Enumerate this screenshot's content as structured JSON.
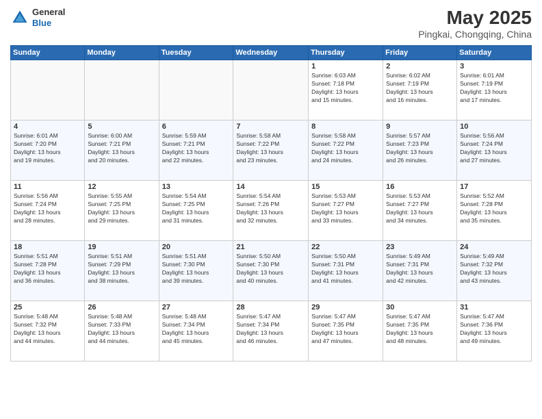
{
  "header": {
    "logo": {
      "general": "General",
      "blue": "Blue"
    },
    "title": "May 2025",
    "subtitle": "Pingkai, Chongqing, China"
  },
  "weekdays": [
    "Sunday",
    "Monday",
    "Tuesday",
    "Wednesday",
    "Thursday",
    "Friday",
    "Saturday"
  ],
  "weeks": [
    [
      {
        "day": "",
        "info": ""
      },
      {
        "day": "",
        "info": ""
      },
      {
        "day": "",
        "info": ""
      },
      {
        "day": "",
        "info": ""
      },
      {
        "day": "1",
        "info": "Sunrise: 6:03 AM\nSunset: 7:18 PM\nDaylight: 13 hours\nand 15 minutes."
      },
      {
        "day": "2",
        "info": "Sunrise: 6:02 AM\nSunset: 7:19 PM\nDaylight: 13 hours\nand 16 minutes."
      },
      {
        "day": "3",
        "info": "Sunrise: 6:01 AM\nSunset: 7:19 PM\nDaylight: 13 hours\nand 17 minutes."
      }
    ],
    [
      {
        "day": "4",
        "info": "Sunrise: 6:01 AM\nSunset: 7:20 PM\nDaylight: 13 hours\nand 19 minutes."
      },
      {
        "day": "5",
        "info": "Sunrise: 6:00 AM\nSunset: 7:21 PM\nDaylight: 13 hours\nand 20 minutes."
      },
      {
        "day": "6",
        "info": "Sunrise: 5:59 AM\nSunset: 7:21 PM\nDaylight: 13 hours\nand 22 minutes."
      },
      {
        "day": "7",
        "info": "Sunrise: 5:58 AM\nSunset: 7:22 PM\nDaylight: 13 hours\nand 23 minutes."
      },
      {
        "day": "8",
        "info": "Sunrise: 5:58 AM\nSunset: 7:22 PM\nDaylight: 13 hours\nand 24 minutes."
      },
      {
        "day": "9",
        "info": "Sunrise: 5:57 AM\nSunset: 7:23 PM\nDaylight: 13 hours\nand 26 minutes."
      },
      {
        "day": "10",
        "info": "Sunrise: 5:56 AM\nSunset: 7:24 PM\nDaylight: 13 hours\nand 27 minutes."
      }
    ],
    [
      {
        "day": "11",
        "info": "Sunrise: 5:56 AM\nSunset: 7:24 PM\nDaylight: 13 hours\nand 28 minutes."
      },
      {
        "day": "12",
        "info": "Sunrise: 5:55 AM\nSunset: 7:25 PM\nDaylight: 13 hours\nand 29 minutes."
      },
      {
        "day": "13",
        "info": "Sunrise: 5:54 AM\nSunset: 7:25 PM\nDaylight: 13 hours\nand 31 minutes."
      },
      {
        "day": "14",
        "info": "Sunrise: 5:54 AM\nSunset: 7:26 PM\nDaylight: 13 hours\nand 32 minutes."
      },
      {
        "day": "15",
        "info": "Sunrise: 5:53 AM\nSunset: 7:27 PM\nDaylight: 13 hours\nand 33 minutes."
      },
      {
        "day": "16",
        "info": "Sunrise: 5:53 AM\nSunset: 7:27 PM\nDaylight: 13 hours\nand 34 minutes."
      },
      {
        "day": "17",
        "info": "Sunrise: 5:52 AM\nSunset: 7:28 PM\nDaylight: 13 hours\nand 35 minutes."
      }
    ],
    [
      {
        "day": "18",
        "info": "Sunrise: 5:51 AM\nSunset: 7:28 PM\nDaylight: 13 hours\nand 36 minutes."
      },
      {
        "day": "19",
        "info": "Sunrise: 5:51 AM\nSunset: 7:29 PM\nDaylight: 13 hours\nand 38 minutes."
      },
      {
        "day": "20",
        "info": "Sunrise: 5:51 AM\nSunset: 7:30 PM\nDaylight: 13 hours\nand 39 minutes."
      },
      {
        "day": "21",
        "info": "Sunrise: 5:50 AM\nSunset: 7:30 PM\nDaylight: 13 hours\nand 40 minutes."
      },
      {
        "day": "22",
        "info": "Sunrise: 5:50 AM\nSunset: 7:31 PM\nDaylight: 13 hours\nand 41 minutes."
      },
      {
        "day": "23",
        "info": "Sunrise: 5:49 AM\nSunset: 7:31 PM\nDaylight: 13 hours\nand 42 minutes."
      },
      {
        "day": "24",
        "info": "Sunrise: 5:49 AM\nSunset: 7:32 PM\nDaylight: 13 hours\nand 43 minutes."
      }
    ],
    [
      {
        "day": "25",
        "info": "Sunrise: 5:48 AM\nSunset: 7:32 PM\nDaylight: 13 hours\nand 44 minutes."
      },
      {
        "day": "26",
        "info": "Sunrise: 5:48 AM\nSunset: 7:33 PM\nDaylight: 13 hours\nand 44 minutes."
      },
      {
        "day": "27",
        "info": "Sunrise: 5:48 AM\nSunset: 7:34 PM\nDaylight: 13 hours\nand 45 minutes."
      },
      {
        "day": "28",
        "info": "Sunrise: 5:47 AM\nSunset: 7:34 PM\nDaylight: 13 hours\nand 46 minutes."
      },
      {
        "day": "29",
        "info": "Sunrise: 5:47 AM\nSunset: 7:35 PM\nDaylight: 13 hours\nand 47 minutes."
      },
      {
        "day": "30",
        "info": "Sunrise: 5:47 AM\nSunset: 7:35 PM\nDaylight: 13 hours\nand 48 minutes."
      },
      {
        "day": "31",
        "info": "Sunrise: 5:47 AM\nSunset: 7:36 PM\nDaylight: 13 hours\nand 49 minutes."
      }
    ]
  ]
}
